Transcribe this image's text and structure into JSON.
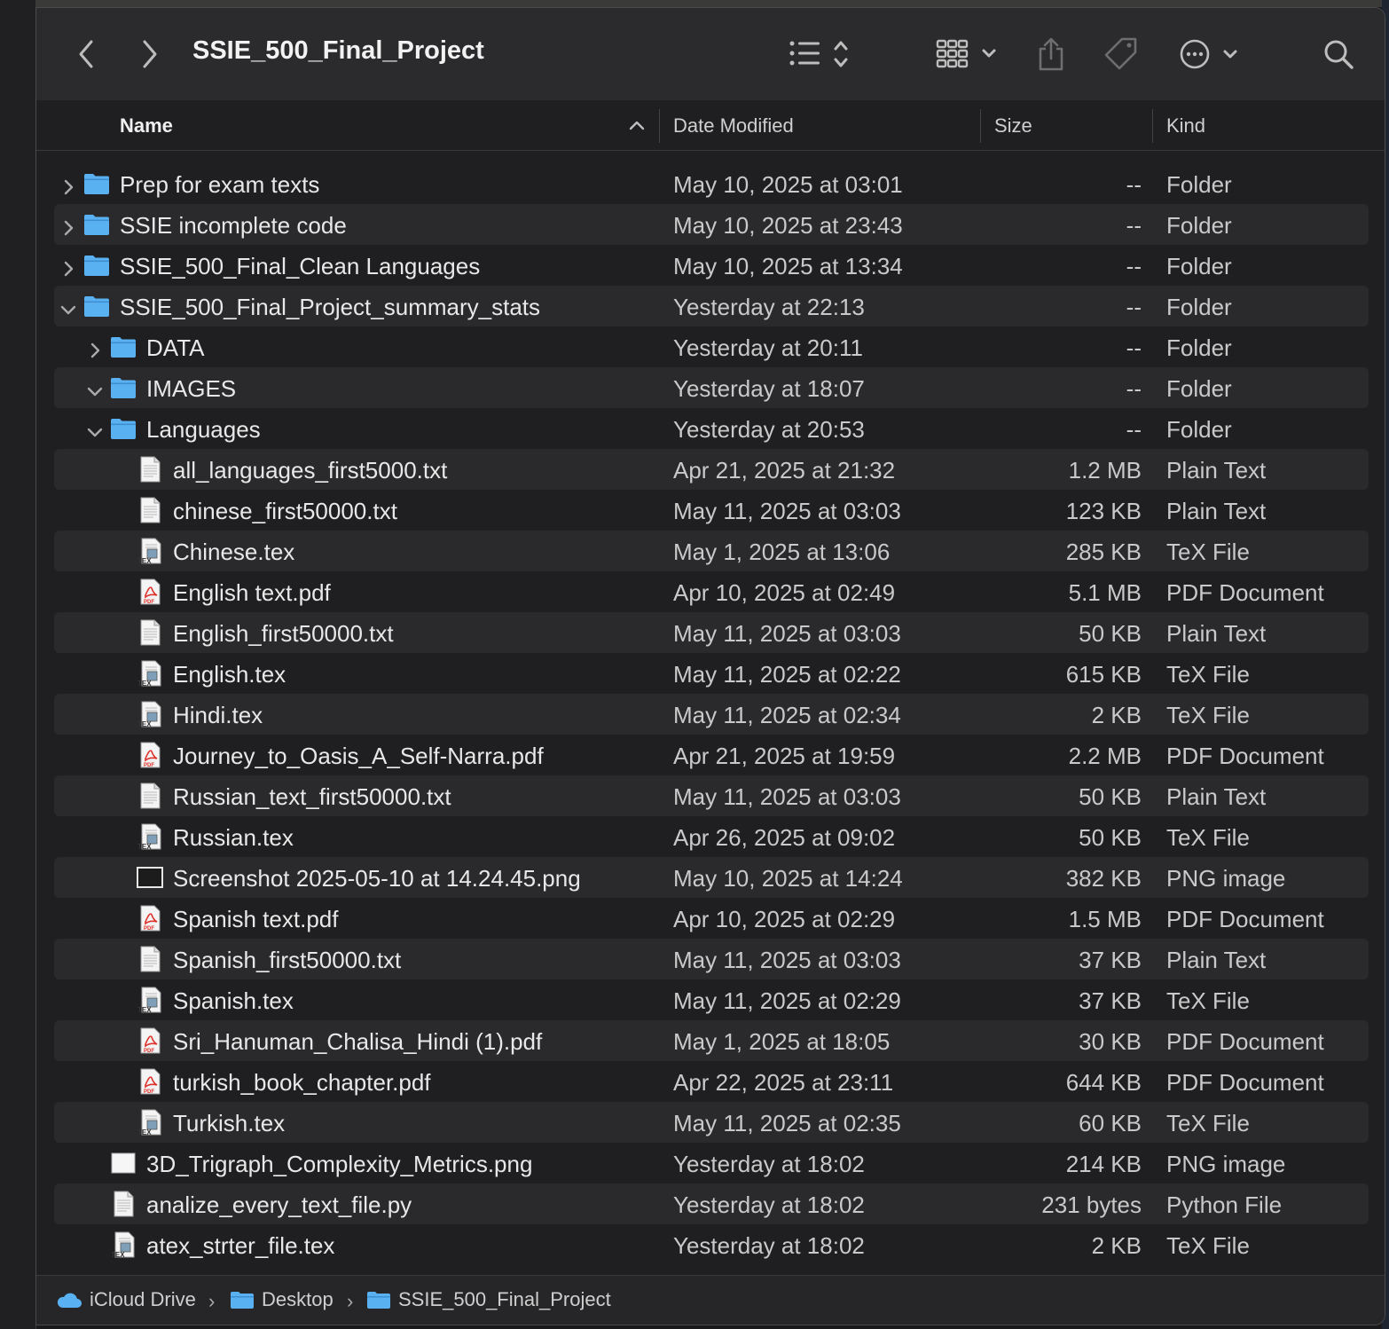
{
  "window": {
    "title": "SSIE_500_Final_Project"
  },
  "toolbar": {
    "back_icon": "chevron-left-icon",
    "forward_icon": "chevron-right-icon",
    "view_icon": "list-view-icon",
    "group_icon": "icon-grid-icon",
    "share_icon": "share-icon",
    "tag_icon": "tag-icon",
    "more_icon": "ellipsis-circle-icon",
    "search_icon": "search-icon"
  },
  "columns": {
    "name": "Name",
    "date": "Date Modified",
    "size": "Size",
    "kind": "Kind"
  },
  "rows": [
    {
      "name": "Prep for exam texts",
      "date": "May 10, 2025 at 03:01",
      "size": "--",
      "kind": "Folder",
      "type": "folder",
      "level": 0,
      "expand": "collapsed"
    },
    {
      "name": "SSIE incomplete code",
      "date": "May 10, 2025 at 23:43",
      "size": "--",
      "kind": "Folder",
      "type": "folder",
      "level": 0,
      "expand": "collapsed"
    },
    {
      "name": "SSIE_500_Final_Clean Languages",
      "date": "May 10, 2025 at 13:34",
      "size": "--",
      "kind": "Folder",
      "type": "folder",
      "level": 0,
      "expand": "collapsed"
    },
    {
      "name": "SSIE_500_Final_Project_summary_stats",
      "date": "Yesterday at 22:13",
      "size": "--",
      "kind": "Folder",
      "type": "folder",
      "level": 0,
      "expand": "expanded"
    },
    {
      "name": "DATA",
      "date": "Yesterday at 20:11",
      "size": "--",
      "kind": "Folder",
      "type": "folder",
      "level": 1,
      "expand": "collapsed"
    },
    {
      "name": "IMAGES",
      "date": "Yesterday at 18:07",
      "size": "--",
      "kind": "Folder",
      "type": "folder",
      "level": 1,
      "expand": "expanded"
    },
    {
      "name": "Languages",
      "date": "Yesterday at 20:53",
      "size": "--",
      "kind": "Folder",
      "type": "folder",
      "level": 1,
      "expand": "expanded"
    },
    {
      "name": "all_languages_first5000.txt",
      "date": "Apr 21, 2025 at 21:32",
      "size": "1.2 MB",
      "kind": "Plain Text",
      "type": "txt",
      "level": 2,
      "expand": "none"
    },
    {
      "name": "chinese_first50000.txt",
      "date": "May 11, 2025 at 03:03",
      "size": "123 KB",
      "kind": "Plain Text",
      "type": "txt",
      "level": 2,
      "expand": "none"
    },
    {
      "name": "Chinese.tex",
      "date": "May 1, 2025 at 13:06",
      "size": "285 KB",
      "kind": "TeX File",
      "type": "tex",
      "level": 2,
      "expand": "none"
    },
    {
      "name": "English text.pdf",
      "date": "Apr 10, 2025 at 02:49",
      "size": "5.1 MB",
      "kind": "PDF Document",
      "type": "pdf",
      "level": 2,
      "expand": "none"
    },
    {
      "name": "English_first50000.txt",
      "date": "May 11, 2025 at 03:03",
      "size": "50 KB",
      "kind": "Plain Text",
      "type": "txt",
      "level": 2,
      "expand": "none"
    },
    {
      "name": "English.tex",
      "date": "May 11, 2025 at 02:22",
      "size": "615 KB",
      "kind": "TeX File",
      "type": "tex",
      "level": 2,
      "expand": "none"
    },
    {
      "name": "Hindi.tex",
      "date": "May 11, 2025 at 02:34",
      "size": "2 KB",
      "kind": "TeX File",
      "type": "tex",
      "level": 2,
      "expand": "none"
    },
    {
      "name": "Journey_to_Oasis_A_Self-Narra.pdf",
      "date": "Apr 21, 2025 at 19:59",
      "size": "2.2 MB",
      "kind": "PDF Document",
      "type": "pdf",
      "level": 2,
      "expand": "none"
    },
    {
      "name": "Russian_text_first50000.txt",
      "date": "May 11, 2025 at 03:03",
      "size": "50 KB",
      "kind": "Plain Text",
      "type": "txt",
      "level": 2,
      "expand": "none"
    },
    {
      "name": "Russian.tex",
      "date": "Apr 26, 2025 at 09:02",
      "size": "50 KB",
      "kind": "TeX File",
      "type": "tex",
      "level": 2,
      "expand": "none"
    },
    {
      "name": "Screenshot 2025-05-10 at 14.24.45.png",
      "date": "May 10, 2025 at 14:24",
      "size": "382 KB",
      "kind": "PNG image",
      "type": "png-dark",
      "level": 2,
      "expand": "none"
    },
    {
      "name": "Spanish text.pdf",
      "date": "Apr 10, 2025 at 02:29",
      "size": "1.5 MB",
      "kind": "PDF Document",
      "type": "pdf",
      "level": 2,
      "expand": "none"
    },
    {
      "name": "Spanish_first50000.txt",
      "date": "May 11, 2025 at 03:03",
      "size": "37 KB",
      "kind": "Plain Text",
      "type": "txt",
      "level": 2,
      "expand": "none"
    },
    {
      "name": "Spanish.tex",
      "date": "May 11, 2025 at 02:29",
      "size": "37 KB",
      "kind": "TeX File",
      "type": "tex",
      "level": 2,
      "expand": "none"
    },
    {
      "name": "Sri_Hanuman_Chalisa_Hindi (1).pdf",
      "date": "May 1, 2025 at 18:05",
      "size": "30 KB",
      "kind": "PDF Document",
      "type": "pdf",
      "level": 2,
      "expand": "none"
    },
    {
      "name": "turkish_book_chapter.pdf",
      "date": "Apr 22, 2025 at 23:11",
      "size": "644 KB",
      "kind": "PDF Document",
      "type": "pdf",
      "level": 2,
      "expand": "none"
    },
    {
      "name": "Turkish.tex",
      "date": "May 11, 2025 at 02:35",
      "size": "60 KB",
      "kind": "TeX File",
      "type": "tex",
      "level": 2,
      "expand": "none"
    },
    {
      "name": "3D_Trigraph_Complexity_Metrics.png",
      "date": "Yesterday at 18:02",
      "size": "214 KB",
      "kind": "PNG image",
      "type": "png-light",
      "level": 1,
      "expand": "none"
    },
    {
      "name": "analize_every_text_file.py",
      "date": "Yesterday at 18:02",
      "size": "231 bytes",
      "kind": "Python File",
      "type": "txt",
      "level": 1,
      "expand": "none"
    },
    {
      "name": "atex_strter_file.tex",
      "date": "Yesterday at 18:02",
      "size": "2 KB",
      "kind": "TeX File",
      "type": "tex",
      "level": 1,
      "expand": "none"
    }
  ],
  "pathbar": {
    "items": [
      {
        "label": "iCloud Drive",
        "icon": "cloud-icon"
      },
      {
        "label": "Desktop",
        "icon": "folder-icon"
      },
      {
        "label": "SSIE_500_Final_Project",
        "icon": "folder-icon"
      }
    ]
  },
  "colors": {
    "folder": "#5ab1f2",
    "pdf": "#e0302a",
    "selection": "#2a2a2c"
  }
}
